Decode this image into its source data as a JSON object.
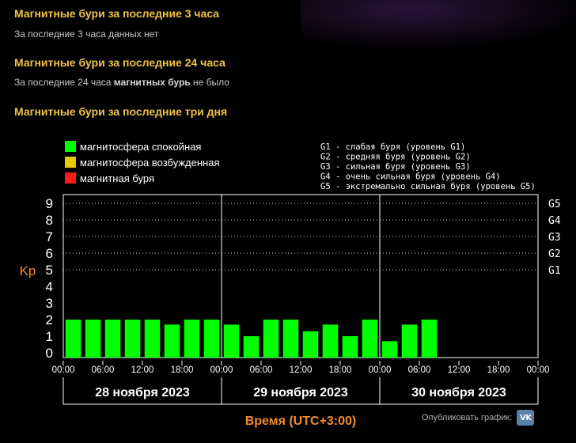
{
  "sections": [
    {
      "title": "Магнитные бури за последние 3 часа",
      "text": "За последние 3 часа данных нет"
    },
    {
      "title": "Магнитные бури за последние 24 часа",
      "text_pre": "За последние 24 часа ",
      "text_bold": "магнитных бурь",
      "text_post": " не было"
    },
    {
      "title": "Магнитные бури за последние три дня"
    }
  ],
  "colors": {
    "calm": "#00ff00",
    "excited": "#e8c800",
    "storm": "#ff1a1a",
    "axis_title": "#f08a30"
  },
  "chart_data": {
    "type": "bar",
    "ylabel": "Kp",
    "xlabel": "Время (UTC+3:00)",
    "ylim": [
      0,
      9
    ],
    "yticks": [
      "0",
      "1",
      "2",
      "3",
      "4",
      "5",
      "6",
      "7",
      "8",
      "9"
    ],
    "storm_levels": [
      {
        "kp": 5,
        "label": "G1"
      },
      {
        "kp": 6,
        "label": "G2"
      },
      {
        "kp": 7,
        "label": "G3"
      },
      {
        "kp": 8,
        "label": "G4"
      },
      {
        "kp": 9,
        "label": "G5"
      }
    ],
    "legend": [
      {
        "label": "магнитосфера спокойная",
        "color": "#00ff00"
      },
      {
        "label": "магнитосфера возбужденная",
        "color": "#e8c800"
      },
      {
        "label": "магнитная буря",
        "color": "#ff1a1a"
      }
    ],
    "storm_legend": [
      "G1 - слабая буря (уровень G1)",
      "G2 - средняя буря (уровень G2)",
      "G3 - сильная буря (уровень G3)",
      "G4 - очень сильная буря (уровень G4)",
      "G5 - экстремально сильная буря (уровень G5)"
    ],
    "days": [
      {
        "label": "28 ноября 2023",
        "time_labels": [
          "00:00",
          "06:00",
          "12:00",
          "18:00"
        ],
        "values": [
          2.0,
          2.0,
          2.0,
          2.0,
          2.0,
          1.7,
          2.0,
          2.0
        ]
      },
      {
        "label": "29 ноября 2023",
        "time_labels": [
          "00:00",
          "06:00",
          "12:00",
          "18:00"
        ],
        "values": [
          1.7,
          1.0,
          2.0,
          2.0,
          1.3,
          1.7,
          1.0,
          2.0
        ]
      },
      {
        "label": "30 ноября 2023",
        "time_labels": [
          "00:00",
          "06:00",
          "12:00",
          "18:00",
          "00:00"
        ],
        "values": [
          0.7,
          1.7,
          2.0
        ]
      }
    ]
  },
  "publish": {
    "label": "Опубликовать график:",
    "icon": "vk-icon",
    "icon_text": "VK"
  }
}
